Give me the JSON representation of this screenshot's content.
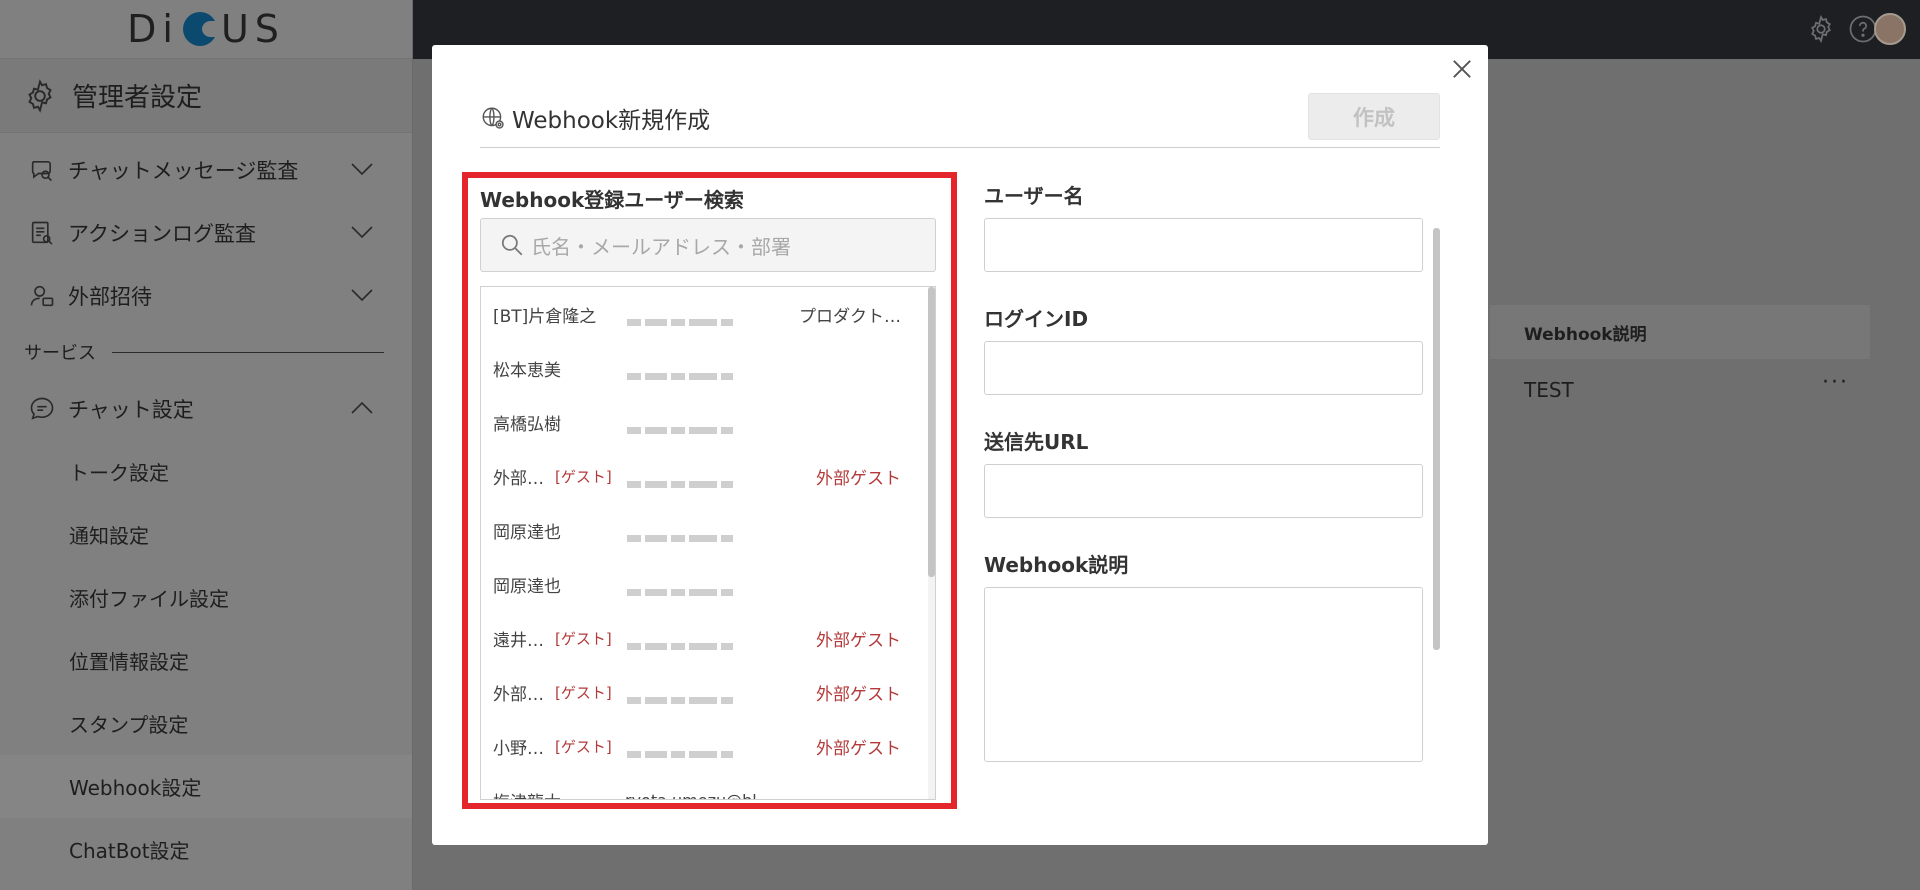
{
  "brand": {
    "logo_text_left": "Di",
    "logo_text_right": "US",
    "logo_full": "DISCUS"
  },
  "sidebar": {
    "admin_title": "管理者設定",
    "items": [
      {
        "label": "チャットメッセージ監査",
        "icon": "chat-audit-icon",
        "expanded": false
      },
      {
        "label": "アクションログ監査",
        "icon": "log-audit-icon",
        "expanded": false
      },
      {
        "label": "外部招待",
        "icon": "invite-icon",
        "expanded": false
      }
    ],
    "section_label": "サービス",
    "chat_settings": {
      "label": "チャット設定",
      "icon": "chat-icon",
      "expanded": true
    },
    "sub_items": [
      {
        "label": "トーク設定"
      },
      {
        "label": "通知設定"
      },
      {
        "label": "添付ファイル設定"
      },
      {
        "label": "位置情報設定"
      },
      {
        "label": "スタンプ設定"
      },
      {
        "label": "Webhook設定",
        "active": true
      },
      {
        "label": "ChatBot設定"
      }
    ]
  },
  "background": {
    "table_header": "Webhook説明",
    "row_text": "TEST",
    "row_menu": "···"
  },
  "modal": {
    "title": "Webhook新規作成",
    "create_label": "作成",
    "search_section_title": "Webhook登録ユーザー検索",
    "search_placeholder": "氏名・メールアドレス・部署",
    "users": [
      {
        "name": "[BT]片倉隆之",
        "guest_tag": "",
        "dept": "プロダクト…",
        "dept_guest": false
      },
      {
        "name": "松本恵美",
        "guest_tag": "",
        "dept": "",
        "dept_guest": false
      },
      {
        "name": "高橋弘樹",
        "guest_tag": "",
        "dept": "",
        "dept_guest": false
      },
      {
        "name": "外部…",
        "guest_tag": "[ゲスト]",
        "dept": "外部ゲスト",
        "dept_guest": true
      },
      {
        "name": "岡原達也",
        "guest_tag": "",
        "dept": "",
        "dept_guest": false
      },
      {
        "name": "岡原達也",
        "guest_tag": "",
        "dept": "",
        "dept_guest": false
      },
      {
        "name": "遠井…",
        "guest_tag": "[ゲスト]",
        "dept": "外部ゲスト",
        "dept_guest": true
      },
      {
        "name": "外部…",
        "guest_tag": "[ゲスト]",
        "dept": "外部ゲスト",
        "dept_guest": true
      },
      {
        "name": "小野…",
        "guest_tag": "[ゲスト]",
        "dept": "外部ゲスト",
        "dept_guest": true
      },
      {
        "name": "梅津龍太",
        "guest_tag": "",
        "dept": "",
        "dept_guest": false,
        "email_partial": "ryota.umezu@bl"
      }
    ],
    "fields": {
      "username_label": "ユーザー名",
      "login_id_label": "ログインID",
      "url_label": "送信先URL",
      "description_label": "Webhook説明"
    }
  },
  "colors": {
    "highlight_border": "#e4262c",
    "guest_text": "#b33a3a",
    "topbar": "#1d1f23"
  }
}
